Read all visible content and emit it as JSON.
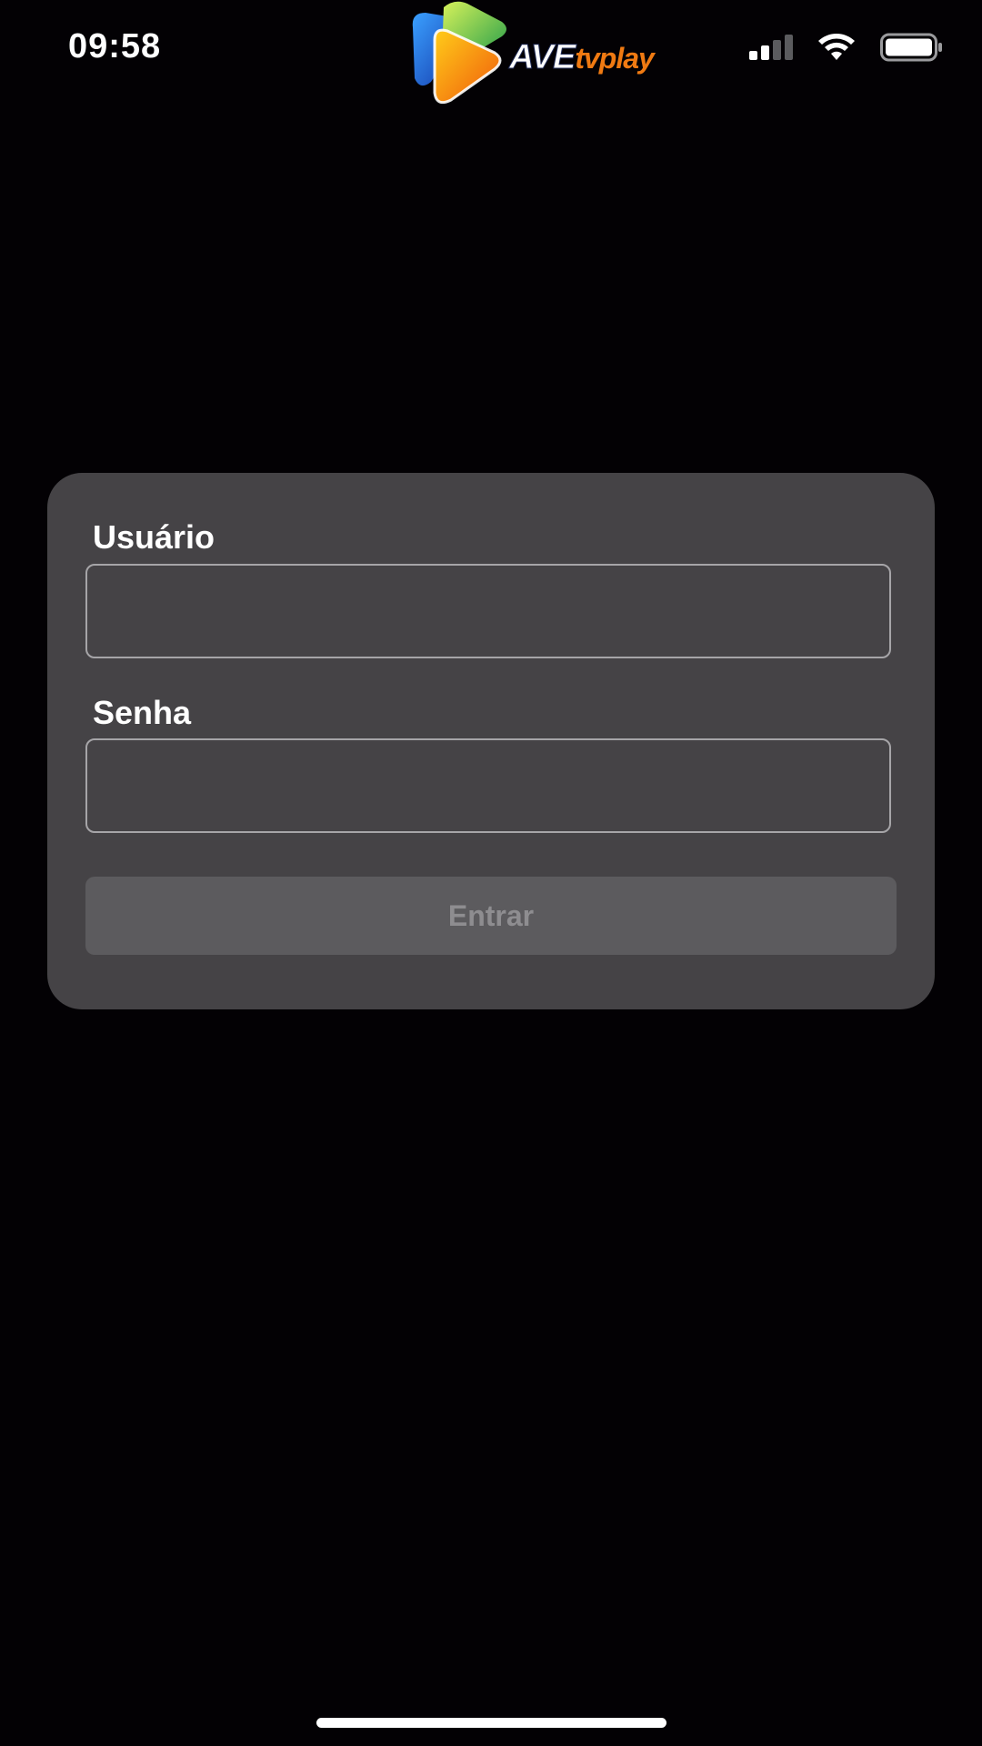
{
  "status_bar": {
    "time": "09:58",
    "signal_icon": "signal-icon",
    "wifi_icon": "wifi-icon",
    "battery_icon": "battery-icon"
  },
  "logo": {
    "brand_part1": "AVE",
    "brand_part2": "tvplay",
    "colors": {
      "accent_orange": "#f07a12",
      "blue": "#1f5bd6",
      "green": "#3fbf3a"
    }
  },
  "login_form": {
    "username_label": "Usuário",
    "username_value": "",
    "password_label": "Senha",
    "password_value": "",
    "submit_label": "Entrar"
  },
  "colors": {
    "background": "#030104",
    "card": "#454346",
    "button_disabled": "#5c5b5e",
    "button_text_disabled": "#8e8d90"
  }
}
